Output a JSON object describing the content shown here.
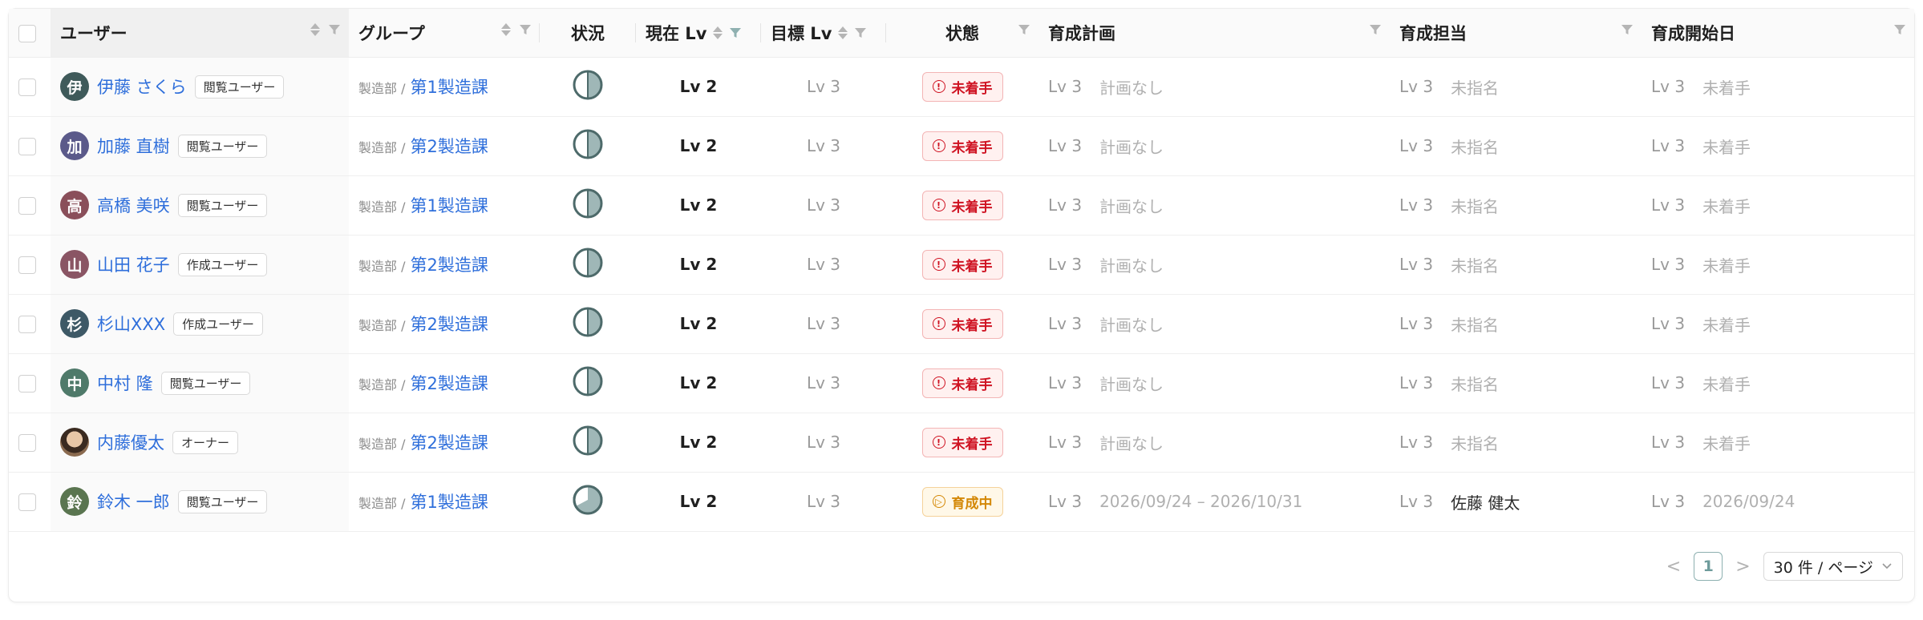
{
  "columns": {
    "user": "ユーザー",
    "group": "グループ",
    "status_icon": "状況",
    "current_lv": "現在 Lv",
    "target_lv": "目標 Lv",
    "state": "状態",
    "plan": "育成計画",
    "owner": "育成担当",
    "start_date": "育成開始日"
  },
  "rows": [
    {
      "avatar": "伊",
      "avatar_color": "#3f5a5a",
      "name": "伊藤 さくら",
      "role": "閲覧ユーザー",
      "dept": "製造部 /",
      "group": "第1製造課",
      "current": "Lv 2",
      "target": "Lv 3",
      "state": "未着手",
      "state_tone": "red",
      "state_icon": "!",
      "plan_lv": "Lv 3",
      "plan": "計画なし",
      "owner_lv": "Lv 3",
      "owner": "未指名",
      "start_lv": "Lv 3",
      "start": "未着手",
      "progress": "half"
    },
    {
      "avatar": "加",
      "avatar_color": "#5b5a8a",
      "name": "加藤 直樹",
      "role": "閲覧ユーザー",
      "dept": "製造部 /",
      "group": "第2製造課",
      "current": "Lv 2",
      "target": "Lv 3",
      "state": "未着手",
      "state_tone": "red",
      "state_icon": "!",
      "plan_lv": "Lv 3",
      "plan": "計画なし",
      "owner_lv": "Lv 3",
      "owner": "未指名",
      "start_lv": "Lv 3",
      "start": "未着手",
      "progress": "half"
    },
    {
      "avatar": "高",
      "avatar_color": "#8a4f5a",
      "name": "高橋 美咲",
      "role": "閲覧ユーザー",
      "dept": "製造部 /",
      "group": "第1製造課",
      "current": "Lv 2",
      "target": "Lv 3",
      "state": "未着手",
      "state_tone": "red",
      "state_icon": "!",
      "plan_lv": "Lv 3",
      "plan": "計画なし",
      "owner_lv": "Lv 3",
      "owner": "未指名",
      "start_lv": "Lv 3",
      "start": "未着手",
      "progress": "half"
    },
    {
      "avatar": "山",
      "avatar_color": "#8a5564",
      "name": "山田 花子",
      "role": "作成ユーザー",
      "dept": "製造部 /",
      "group": "第2製造課",
      "current": "Lv 2",
      "target": "Lv 3",
      "state": "未着手",
      "state_tone": "red",
      "state_icon": "!",
      "plan_lv": "Lv 3",
      "plan": "計画なし",
      "owner_lv": "Lv 3",
      "owner": "未指名",
      "start_lv": "Lv 3",
      "start": "未着手",
      "progress": "half"
    },
    {
      "avatar": "杉",
      "avatar_color": "#3e5966",
      "name": "杉山XXX",
      "role": "作成ユーザー",
      "dept": "製造部 /",
      "group": "第2製造課",
      "current": "Lv 2",
      "target": "Lv 3",
      "state": "未着手",
      "state_tone": "red",
      "state_icon": "!",
      "plan_lv": "Lv 3",
      "plan": "計画なし",
      "owner_lv": "Lv 3",
      "owner": "未指名",
      "start_lv": "Lv 3",
      "start": "未着手",
      "progress": "half"
    },
    {
      "avatar": "中",
      "avatar_color": "#4f7a6a",
      "name": "中村 隆",
      "role": "閲覧ユーザー",
      "dept": "製造部 /",
      "group": "第2製造課",
      "current": "Lv 2",
      "target": "Lv 3",
      "state": "未着手",
      "state_tone": "red",
      "state_icon": "!",
      "plan_lv": "Lv 3",
      "plan": "計画なし",
      "owner_lv": "Lv 3",
      "owner": "未指名",
      "start_lv": "Lv 3",
      "start": "未着手",
      "progress": "half"
    },
    {
      "avatar": "",
      "avatar_color": "photo",
      "name": "内藤優太",
      "role": "オーナー",
      "dept": "製造部 /",
      "group": "第2製造課",
      "current": "Lv 2",
      "target": "Lv 3",
      "state": "未着手",
      "state_tone": "red",
      "state_icon": "!",
      "plan_lv": "Lv 3",
      "plan": "計画なし",
      "owner_lv": "Lv 3",
      "owner": "未指名",
      "start_lv": "Lv 3",
      "start": "未着手",
      "progress": "half"
    },
    {
      "avatar": "鈴",
      "avatar_color": "#5a7550",
      "name": "鈴木 一郎",
      "role": "閲覧ユーザー",
      "dept": "製造部 /",
      "group": "第1製造課",
      "current": "Lv 2",
      "target": "Lv 3",
      "state": "育成中",
      "state_tone": "amber",
      "state_icon": "▷",
      "plan_lv": "Lv 3",
      "plan": "2026/09/24 – 2026/10/31",
      "owner_lv": "Lv 3",
      "owner": "佐藤 健太",
      "start_lv": "Lv 3",
      "start": "2026/09/24",
      "progress": "partial"
    }
  ],
  "pagination": {
    "prev": "<",
    "current_page": "1",
    "next": ">",
    "page_size": "30 件 / ページ"
  },
  "colors": {
    "link": "#2f6fdb",
    "indicator_fill": "#9fb7b7",
    "indicator_border": "#4d6a6a"
  }
}
